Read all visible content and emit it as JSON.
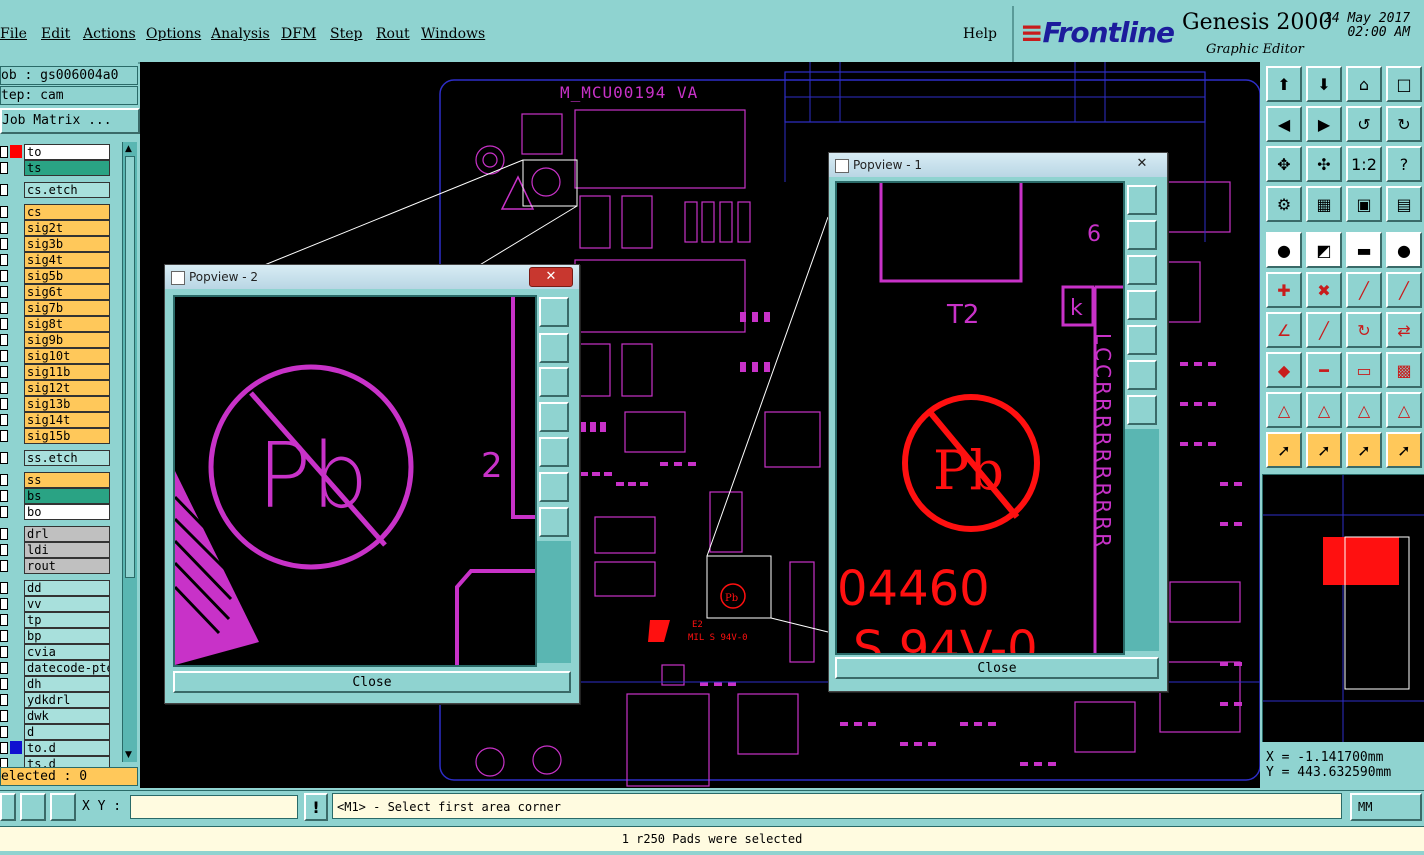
{
  "menu": {
    "file": "File",
    "edit": "Edit",
    "actions": "Actions",
    "options": "Options",
    "analysis": "Analysis",
    "dfm": "DFM",
    "step": "Step",
    "rout": "Rout",
    "windows": "Windows",
    "help": "Help"
  },
  "brand": {
    "logo": "Frontline",
    "product": "Genesis 2000",
    "subtitle": "Graphic Editor",
    "date": "24 May 2017",
    "time": "02:00 AM"
  },
  "left": {
    "job": "ob : gs006004a0",
    "step": "tep: cam",
    "matrix": "Job Matrix ...",
    "selected": "elected : 0",
    "layers": [
      {
        "name": "to",
        "color": "#ffffff",
        "swatch": "#ff0000"
      },
      {
        "name": "ts",
        "color": "#2aa384",
        "swatch": ""
      },
      {
        "name": "cs.etch",
        "color": "#a8e0dc",
        "swatch": ""
      },
      {
        "name": "cs",
        "color": "#ffc85a",
        "swatch": ""
      },
      {
        "name": "sig2t",
        "color": "#ffc85a",
        "swatch": ""
      },
      {
        "name": "sig3b",
        "color": "#ffc85a",
        "swatch": ""
      },
      {
        "name": "sig4t",
        "color": "#ffc85a",
        "swatch": ""
      },
      {
        "name": "sig5b",
        "color": "#ffc85a",
        "swatch": ""
      },
      {
        "name": "sig6t",
        "color": "#ffc85a",
        "swatch": ""
      },
      {
        "name": "sig7b",
        "color": "#ffc85a",
        "swatch": ""
      },
      {
        "name": "sig8t",
        "color": "#ffc85a",
        "swatch": ""
      },
      {
        "name": "sig9b",
        "color": "#ffc85a",
        "swatch": ""
      },
      {
        "name": "sig10t",
        "color": "#ffc85a",
        "swatch": ""
      },
      {
        "name": "sig11b",
        "color": "#ffc85a",
        "swatch": ""
      },
      {
        "name": "sig12t",
        "color": "#ffc85a",
        "swatch": ""
      },
      {
        "name": "sig13b",
        "color": "#ffc85a",
        "swatch": ""
      },
      {
        "name": "sig14t",
        "color": "#ffc85a",
        "swatch": ""
      },
      {
        "name": "sig15b",
        "color": "#ffc85a",
        "swatch": ""
      },
      {
        "name": "ss.etch",
        "color": "#a8e0dc",
        "swatch": ""
      },
      {
        "name": "ss",
        "color": "#ffc85a",
        "swatch": ""
      },
      {
        "name": "bs",
        "color": "#2aa384",
        "swatch": ""
      },
      {
        "name": "bo",
        "color": "#ffffff",
        "swatch": ""
      },
      {
        "name": "drl",
        "color": "#c0c0c0",
        "swatch": ""
      },
      {
        "name": "ldi",
        "color": "#c0c0c0",
        "swatch": ""
      },
      {
        "name": "rout",
        "color": "#c0c0c0",
        "swatch": ""
      },
      {
        "name": "dd",
        "color": "#a8e0dc",
        "swatch": ""
      },
      {
        "name": "vv",
        "color": "#a8e0dc",
        "swatch": ""
      },
      {
        "name": "tp",
        "color": "#a8e0dc",
        "swatch": ""
      },
      {
        "name": "bp",
        "color": "#a8e0dc",
        "swatch": ""
      },
      {
        "name": "cvia",
        "color": "#a8e0dc",
        "swatch": ""
      },
      {
        "name": "datecode-pte",
        "color": "#a8e0dc",
        "swatch": ""
      },
      {
        "name": "dh",
        "color": "#a8e0dc",
        "swatch": ""
      },
      {
        "name": "ydkdrl",
        "color": "#a8e0dc",
        "swatch": ""
      },
      {
        "name": "dwk",
        "color": "#a8e0dc",
        "swatch": ""
      },
      {
        "name": "d",
        "color": "#a8e0dc",
        "swatch": ""
      },
      {
        "name": "to.d",
        "color": "#a8e0dc",
        "swatch": "#1010d0"
      },
      {
        "name": "ts.d",
        "color": "#a8e0dc",
        "swatch": ""
      }
    ]
  },
  "canvas": {
    "board_title": "M_MCU00194 VA",
    "ul_mark": "E2",
    "ul_text": "MIL S 94V-0"
  },
  "popup2": {
    "title": "Popview - 2",
    "close": "Close",
    "pb": "Pb",
    "digit": "2"
  },
  "popup1": {
    "title": "Popview - 1",
    "close": "Close",
    "pb": "Pb",
    "label_t2": "T2",
    "label_k": "k",
    "label_6": "6",
    "big_num": "04460",
    "big_text": "S 94V-0",
    "col_letters": "LCCRRRRRRRRRR"
  },
  "coords": {
    "x": "X = -1.141700mm",
    "y": "Y = 443.632590mm"
  },
  "bottom": {
    "xy_label": "X Y :",
    "xy_value": "",
    "prompt": "<M1> - Select first area corner",
    "units": "MM"
  },
  "status": {
    "message": "1 r250 Pads were selected"
  },
  "colors": {
    "panel": "#8fd3d0",
    "pcb_magenta": "#c832c8",
    "pcb_blue": "#2e2ec8",
    "highlight_red": "#ff1010"
  }
}
